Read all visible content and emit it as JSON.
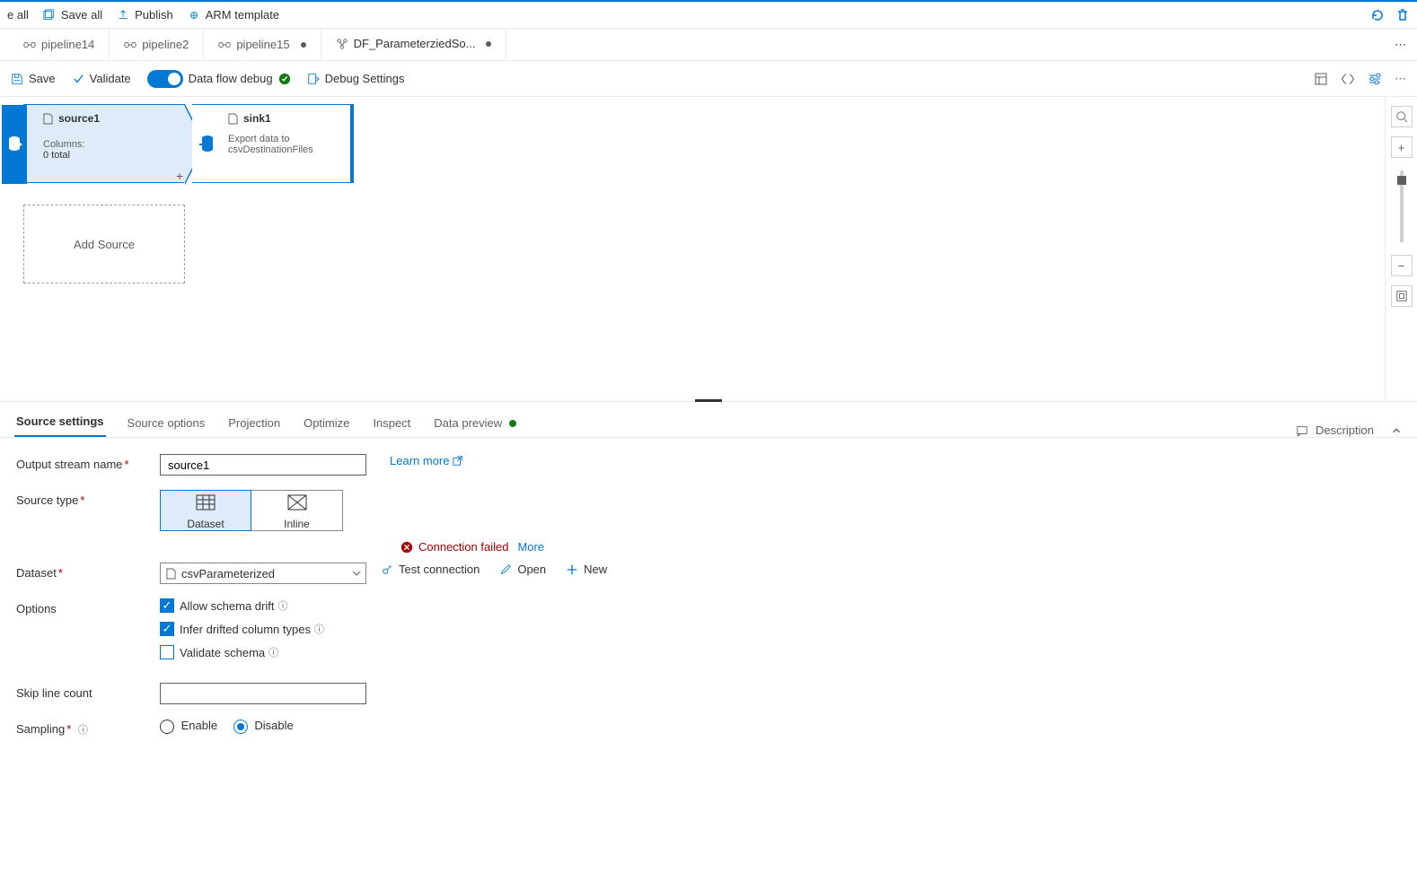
{
  "topbar": {
    "discard": "e all",
    "save_all": "Save all",
    "publish": "Publish",
    "arm": "ARM template"
  },
  "tabs": [
    {
      "label": "pipeline14",
      "dirty": false
    },
    {
      "label": "pipeline2",
      "dirty": false
    },
    {
      "label": "pipeline15",
      "dirty": true
    },
    {
      "label": "DF_ParameterziedSo...",
      "dirty": true
    }
  ],
  "toolbar": {
    "save": "Save",
    "validate": "Validate",
    "debug_toggle": "Data flow debug",
    "debug_settings": "Debug Settings"
  },
  "nodes": {
    "source": {
      "title": "source1",
      "sub1": "Columns:",
      "sub2": "0 total"
    },
    "sink": {
      "title": "sink1",
      "desc": "Export data to csvDestinationFiles"
    },
    "add_source": "Add Source"
  },
  "panel_tabs": {
    "t1": "Source settings",
    "t2": "Source options",
    "t3": "Projection",
    "t4": "Optimize",
    "t5": "Inspect",
    "t6": "Data preview",
    "desc": "Description"
  },
  "form": {
    "output_stream_label": "Output stream name",
    "output_stream_value": "source1",
    "learn_more": "Learn more",
    "source_type_label": "Source type",
    "type_dataset": "Dataset",
    "type_inline": "Inline",
    "conn_failed": "Connection failed",
    "conn_more": "More",
    "dataset_label": "Dataset",
    "dataset_value": "csvParameterized",
    "test_connection": "Test connection",
    "open": "Open",
    "new": "New",
    "options_label": "Options",
    "opt_drift": "Allow schema drift",
    "opt_infer": "Infer drifted column types",
    "opt_validate": "Validate schema",
    "skip_line_label": "Skip line count",
    "skip_line_value": "",
    "sampling_label": "Sampling",
    "sampling_enable": "Enable",
    "sampling_disable": "Disable"
  }
}
